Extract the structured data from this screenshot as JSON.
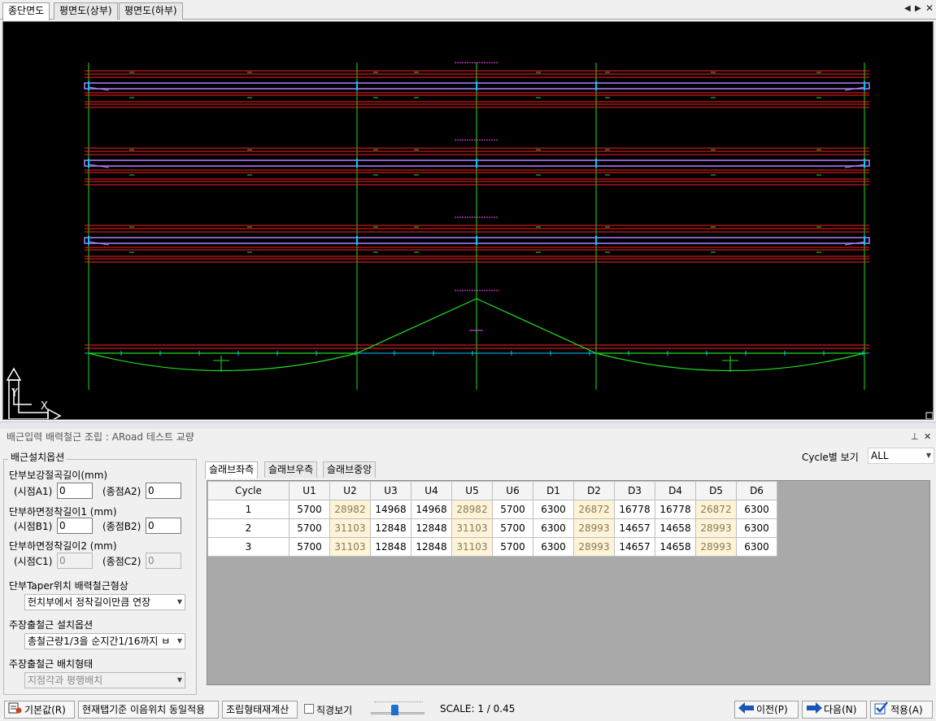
{
  "top_tabs": [
    "종단면도",
    "평면도(상부)",
    "평면도(하부)"
  ],
  "panel": {
    "title": "배근입력 배력철근 조립 : ARoad 테스트 교량"
  },
  "options": {
    "group_title": "배근설치옵션",
    "section1_label": "단부보강절곡길이(mm)",
    "startA1_label": "(시점A1)",
    "startA1_value": "0",
    "endA2_label": "(종점A2)",
    "endA2_value": "0",
    "section2_label": "단부하면정착길이1 (mm)",
    "startB1_label": "(시점B1)",
    "startB1_value": "0",
    "endB2_label": "(종점B2)",
    "endB2_value": "0",
    "section3_label": "단부하면정착길이2 (mm)",
    "startC1_label": "(시점C1)",
    "startC1_value": "0",
    "endC2_label": "(종점C2)",
    "endC2_value": "0",
    "taper_label": "단부Taper위치 배력철근형상",
    "taper_value": "헌치부에서 정착길이만큼 연장",
    "main_opt_label": "주장출철근 설치옵션",
    "main_opt_value": "총철근량1/3을 순지간1/16까지 ㅂ",
    "main_shape_label": "주장출철근 배치형태",
    "main_shape_value": "지점각과 평행배치"
  },
  "cycle_view": {
    "label": "Cycle별 보기",
    "value": "ALL"
  },
  "sub_tabs": [
    "슬래브좌측",
    "슬래브우측",
    "슬래브중앙"
  ],
  "grid": {
    "columns": [
      "Cycle",
      "U1",
      "U2",
      "U3",
      "U4",
      "U5",
      "U6",
      "D1",
      "D2",
      "D3",
      "D4",
      "D5",
      "D6"
    ],
    "rows": [
      [
        "1",
        "5700",
        "28982",
        "14968",
        "14968",
        "28982",
        "5700",
        "6300",
        "26872",
        "16778",
        "16778",
        "26872",
        "6300"
      ],
      [
        "2",
        "5700",
        "31103",
        "12848",
        "12848",
        "31103",
        "5700",
        "6300",
        "28993",
        "14657",
        "14658",
        "28993",
        "6300"
      ],
      [
        "3",
        "5700",
        "31103",
        "12848",
        "12848",
        "31103",
        "5700",
        "6300",
        "28993",
        "14657",
        "14658",
        "28993",
        "6300"
      ]
    ],
    "highlight_columns": [
      2,
      5,
      8,
      11
    ]
  },
  "toolbar": {
    "default_label": "기본값(R)",
    "apply_same_label": "현재탭기준 이음위치 동일적용",
    "recalc_label": "조립형태재계산",
    "diameter_label": "직경보기",
    "scale_text": "SCALE: 1 / 0.45",
    "prev_label": "이전(P)",
    "next_label": "다음(N)",
    "apply_label": "적용(A)"
  },
  "axis": {
    "y_label": "Y",
    "x_label": "X"
  },
  "colors": {
    "cad_bg": "#000000",
    "red": "#ff2020",
    "green": "#20e020",
    "purple": "#b080ff",
    "cyan": "#00c8ff",
    "magenta": "#ff40ff",
    "highlight": "#fdf3d6"
  }
}
